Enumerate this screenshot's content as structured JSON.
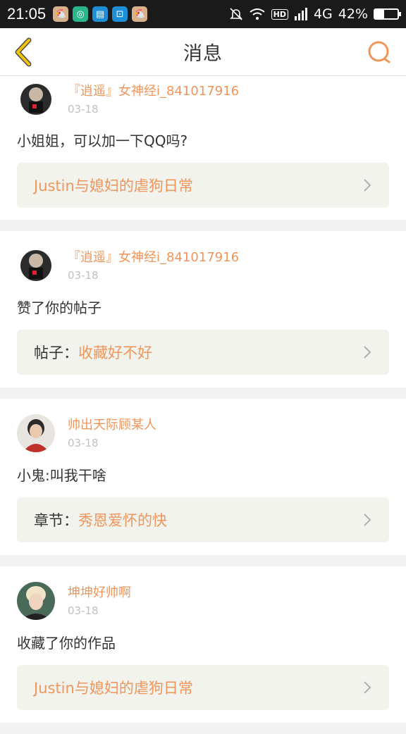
{
  "status_bar": {
    "time": "21:05",
    "network": "4G",
    "battery": "42%",
    "battery_level": 0.42,
    "hd_label": "HD"
  },
  "header": {
    "title": "消息"
  },
  "messages": [
    {
      "username": "『逍遥』女神经i_841017916",
      "time": "03-18",
      "text": "小姐姐，可以加一下QQ吗?",
      "ref_prefix": "",
      "ref_title": "Justin与媳妇的虐狗日常"
    },
    {
      "username": "『逍遥』女神经i_841017916",
      "time": "03-18",
      "text": "赞了你的帖子",
      "ref_prefix": "帖子：",
      "ref_title": "收藏好不好"
    },
    {
      "username": "帅出天际顾某人",
      "time": "03-18",
      "text": "小鬼:叫我干啥",
      "ref_prefix": "章节：",
      "ref_title": "秀恩爱怀的快"
    },
    {
      "username": "坤坤好帅啊",
      "time": "03-18",
      "text": "收藏了你的作品",
      "ref_prefix": "",
      "ref_title": "Justin与媳妇的虐狗日常"
    }
  ],
  "colors": {
    "accent": "#f0955b",
    "back_icon": "#f5c400"
  }
}
